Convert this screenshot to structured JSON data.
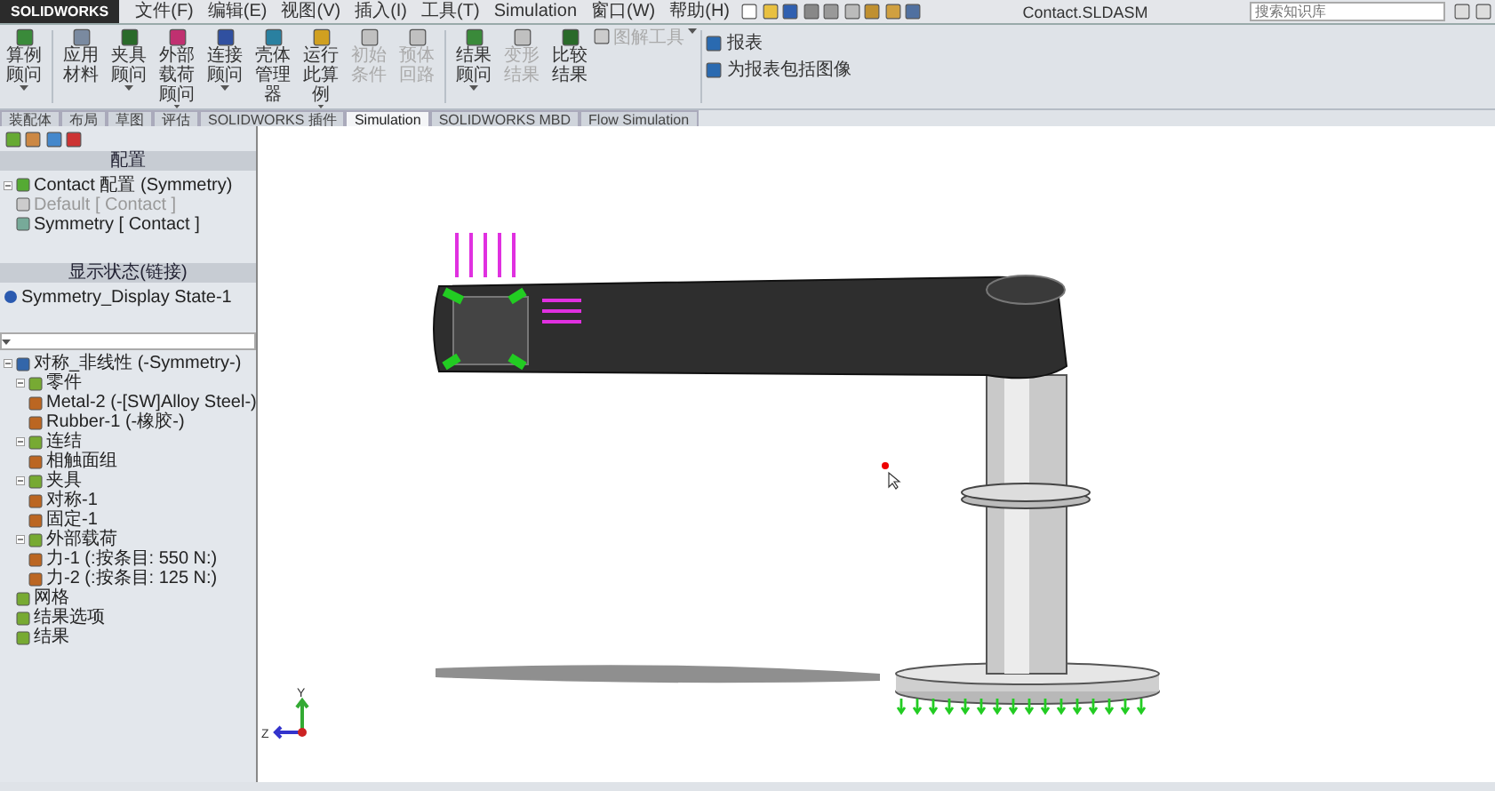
{
  "window": {
    "logo": "SOLIDWORKS",
    "title": "Contact.SLDASM",
    "search": {
      "placeholder": "搜索知识库"
    }
  },
  "menu": [
    "文件(F)",
    "编辑(E)",
    "视图(V)",
    "插入(I)",
    "工具(T)",
    "Simulation",
    "窗口(W)",
    "帮助(H)"
  ],
  "ribbon": [
    {
      "label": "算例顾问",
      "disabled": false,
      "dropdown": true
    },
    {
      "label": "应用材料",
      "disabled": false,
      "dropdown": false
    },
    {
      "label": "夹具顾问",
      "disabled": false,
      "dropdown": true
    },
    {
      "label": "外部载荷顾问",
      "disabled": false,
      "dropdown": true
    },
    {
      "label": "连接顾问",
      "disabled": false,
      "dropdown": true
    },
    {
      "label": "壳体管理器",
      "disabled": false,
      "dropdown": false
    },
    {
      "label": "运行此算例",
      "disabled": false,
      "dropdown": true
    },
    {
      "label": "初始条件",
      "disabled": true,
      "dropdown": false
    },
    {
      "label": "预体回路",
      "disabled": true,
      "dropdown": false
    },
    {
      "label": "结果顾问",
      "disabled": false,
      "dropdown": true
    },
    {
      "label": "变形结果",
      "disabled": true,
      "dropdown": false
    },
    {
      "label": "比较结果",
      "disabled": false,
      "dropdown": false
    }
  ],
  "ribbon_tools": [
    {
      "label": "图解工具",
      "disabled": true
    }
  ],
  "report_buttons": [
    {
      "label": "报表"
    },
    {
      "label": "为报表包括图像"
    }
  ],
  "tabs": [
    {
      "label": "装配体",
      "selected": false
    },
    {
      "label": "布局",
      "selected": false
    },
    {
      "label": "草图",
      "selected": false
    },
    {
      "label": "评估",
      "selected": false
    },
    {
      "label": "SOLIDWORKS 插件",
      "selected": false
    },
    {
      "label": "Simulation",
      "selected": true
    },
    {
      "label": "SOLIDWORKS MBD",
      "selected": false
    },
    {
      "label": "Flow Simulation",
      "selected": false
    }
  ],
  "config_panel": {
    "title": "配置",
    "items": [
      {
        "label": "Contact 配置 (Symmetry)",
        "disabled": false,
        "children": [
          {
            "label": "Default [ Contact ]",
            "disabled": true
          },
          {
            "label": "Symmetry [ Contact ]",
            "disabled": false
          }
        ]
      }
    ]
  },
  "display_panel": {
    "title": "显示状态(链接)",
    "items": [
      {
        "label": "Symmetry_Display State-1"
      }
    ]
  },
  "study_tree": [
    {
      "label": "对称_非线性 (-Symmetry-)",
      "children": [
        {
          "label": "零件",
          "children": [
            {
              "label": "Metal-2 (-[SW]Alloy Steel-)"
            },
            {
              "label": "Rubber-1 (-橡胶-)"
            }
          ]
        },
        {
          "label": "连结",
          "children": [
            {
              "label": "相触面组"
            }
          ]
        },
        {
          "label": "夹具",
          "children": [
            {
              "label": "对称-1"
            },
            {
              "label": "固定-1"
            }
          ]
        },
        {
          "label": "外部载荷",
          "children": [
            {
              "label": "力-1 (:按条目: 550 N:)"
            },
            {
              "label": "力-2 (:按条目: 125 N:)"
            }
          ]
        },
        {
          "label": "网格"
        },
        {
          "label": "结果选项"
        },
        {
          "label": "结果"
        }
      ]
    }
  ],
  "triad": {
    "axes": [
      "Y",
      "Z"
    ]
  }
}
